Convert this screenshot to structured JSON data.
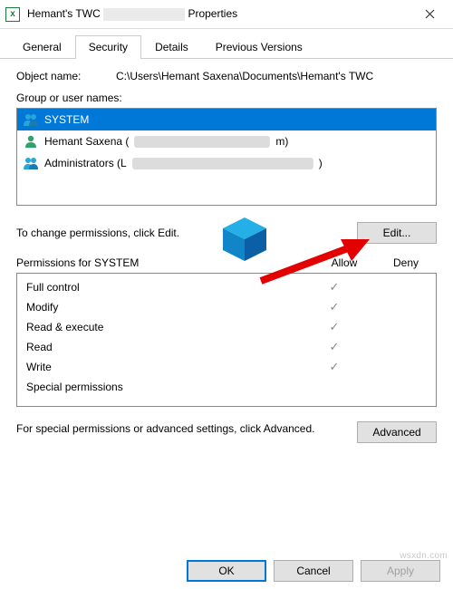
{
  "window": {
    "title_prefix": "Hemant's TWC",
    "title_suffix": "Properties"
  },
  "tabs": {
    "general": "General",
    "security": "Security",
    "details": "Details",
    "previous": "Previous Versions"
  },
  "object": {
    "label": "Object name:",
    "value": "C:\\Users\\Hemant Saxena\\Documents\\Hemant's TWC"
  },
  "groups": {
    "label": "Group or user names:",
    "items": [
      {
        "name": "SYSTEM",
        "suffix": "",
        "selected": true,
        "icon": "group"
      },
      {
        "name": "Hemant Saxena (",
        "suffix": "m)",
        "redact_width": 150,
        "icon": "user"
      },
      {
        "name": "Administrators (L",
        "suffix": ")",
        "redact_width": 200,
        "icon": "group"
      }
    ]
  },
  "change_hint": "To change permissions, click Edit.",
  "buttons": {
    "edit": "Edit...",
    "advanced": "Advanced",
    "ok": "OK",
    "cancel": "Cancel",
    "apply": "Apply"
  },
  "perm": {
    "header_for": "Permissions for SYSTEM",
    "col_allow": "Allow",
    "col_deny": "Deny",
    "rows": [
      {
        "name": "Full control",
        "allow": true,
        "deny": false
      },
      {
        "name": "Modify",
        "allow": true,
        "deny": false
      },
      {
        "name": "Read & execute",
        "allow": true,
        "deny": false
      },
      {
        "name": "Read",
        "allow": true,
        "deny": false
      },
      {
        "name": "Write",
        "allow": true,
        "deny": false
      },
      {
        "name": "Special permissions",
        "allow": false,
        "deny": false
      }
    ]
  },
  "adv_hint": "For special permissions or advanced settings, click Advanced.",
  "check_glyph": "✓",
  "watermark": "wsxdn.com"
}
